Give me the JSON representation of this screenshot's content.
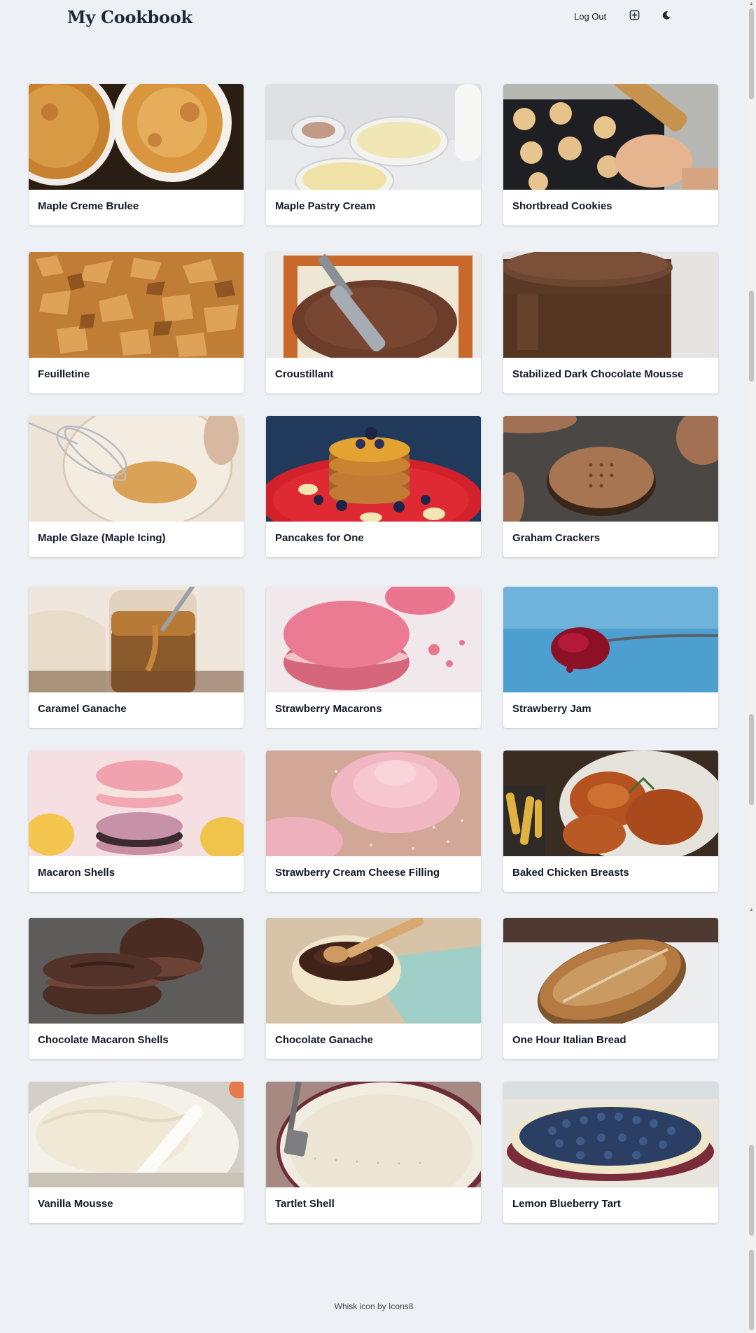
{
  "header": {
    "brand": "My Cookbook",
    "logout_label": "Log Out",
    "icons": [
      "add-recipe-icon",
      "moon-icon"
    ]
  },
  "recipes": [
    {
      "title": "Maple Creme Brulee"
    },
    {
      "title": "Maple Pastry Cream"
    },
    {
      "title": "Shortbread Cookies"
    },
    {
      "title": "Feuilletine"
    },
    {
      "title": "Croustillant"
    },
    {
      "title": "Stabilized Dark Chocolate Mousse"
    },
    {
      "title": "Maple Glaze (Maple Icing)"
    },
    {
      "title": "Pancakes for One"
    },
    {
      "title": "Graham Crackers"
    },
    {
      "title": "Caramel Ganache"
    },
    {
      "title": "Strawberry Macarons"
    },
    {
      "title": "Strawberry Jam"
    },
    {
      "title": "Macaron Shells"
    },
    {
      "title": "Strawberry Cream Cheese Filling"
    },
    {
      "title": "Baked Chicken Breasts"
    },
    {
      "title": "Chocolate Macaron Shells"
    },
    {
      "title": "Chocolate Ganache"
    },
    {
      "title": "One Hour Italian Bread"
    },
    {
      "title": "Vanilla Mousse"
    },
    {
      "title": "Tartlet Shell"
    },
    {
      "title": "Lemon Blueberry Tart"
    }
  ],
  "footer": {
    "credit": "Whisk icon by Icons8"
  },
  "colors": {
    "page_background": "#edf1f5",
    "card_background": "#ffffff",
    "text": "#111827"
  }
}
